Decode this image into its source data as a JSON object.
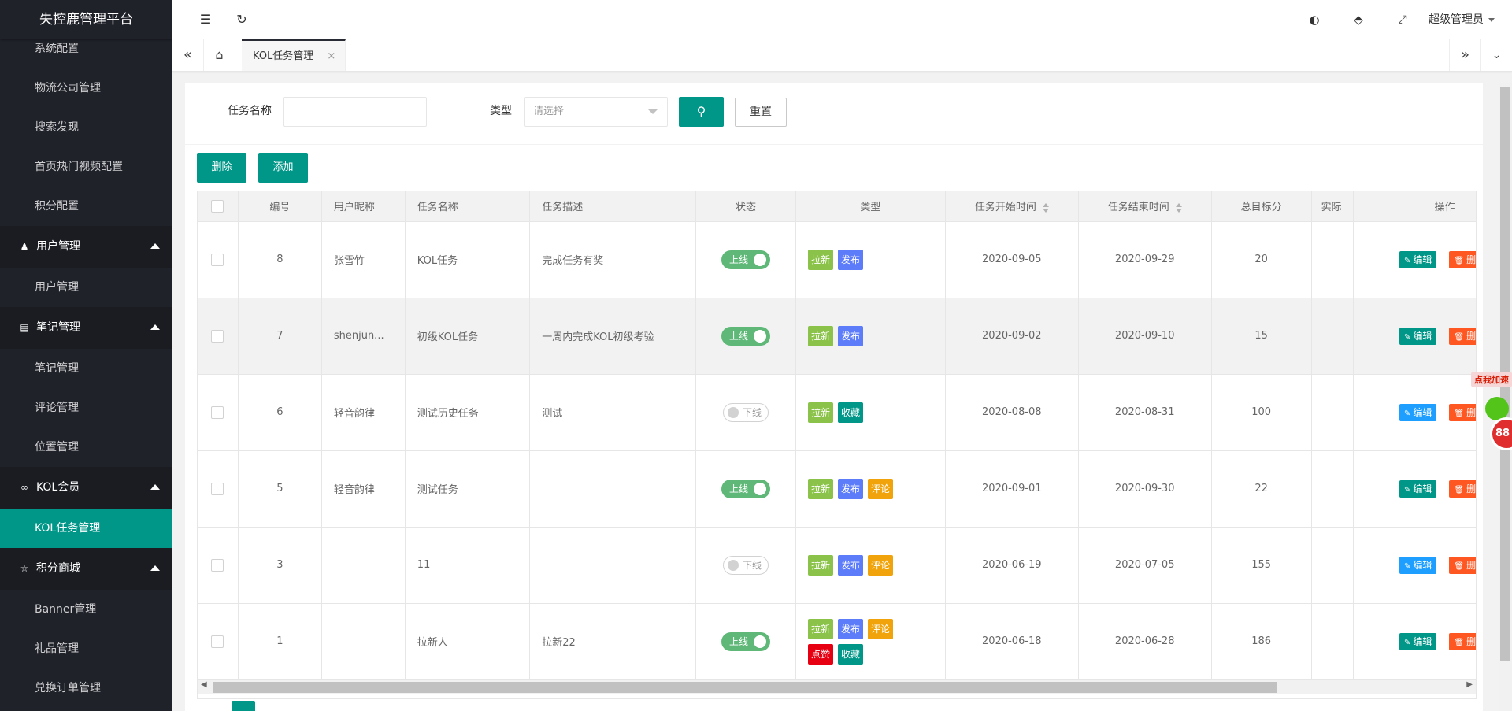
{
  "app": {
    "title": "失控鹿管理平台"
  },
  "sidebar": {
    "items": [
      {
        "label": "系统配置",
        "type": "item"
      },
      {
        "label": "物流公司管理",
        "type": "item"
      },
      {
        "label": "搜索发现",
        "type": "item"
      },
      {
        "label": "首页热门视频配置",
        "type": "item"
      },
      {
        "label": "积分配置",
        "type": "item"
      },
      {
        "label": "用户管理",
        "type": "group",
        "icon": "user-icon"
      },
      {
        "label": "用户管理",
        "type": "item"
      },
      {
        "label": "笔记管理",
        "type": "group",
        "icon": "book-icon"
      },
      {
        "label": "笔记管理",
        "type": "item"
      },
      {
        "label": "评论管理",
        "type": "item"
      },
      {
        "label": "位置管理",
        "type": "item"
      },
      {
        "label": "KOL会员",
        "type": "group",
        "icon": "link-icon"
      },
      {
        "label": "KOL任务管理",
        "type": "item",
        "active": true
      },
      {
        "label": "积分商城",
        "type": "group",
        "icon": "star-icon"
      },
      {
        "label": "Banner管理",
        "type": "item"
      },
      {
        "label": "礼品管理",
        "type": "item"
      },
      {
        "label": "兑换订单管理",
        "type": "item"
      }
    ]
  },
  "header": {
    "user": "超级管理员",
    "icons": [
      "menu-toggle-icon",
      "refresh-icon",
      "theme-icon",
      "tag-icon",
      "fullscreen-icon"
    ]
  },
  "tabs": [
    {
      "label": "KOL任务管理",
      "close": "×"
    }
  ],
  "filters": {
    "name_label": "任务名称",
    "name_value": "",
    "type_label": "类型",
    "type_placeholder": "请选择",
    "reset_label": "重置"
  },
  "toolbar": {
    "delete_label": "删除",
    "add_label": "添加"
  },
  "table": {
    "columns": [
      "编号",
      "用户昵称",
      "任务名称",
      "任务描述",
      "状态",
      "类型",
      "任务开始时间",
      "任务结束时间",
      "总目标分",
      "实际",
      "操作"
    ],
    "edit_label": "编辑",
    "delete_label": "删除",
    "rows": [
      {
        "id": "8",
        "user": "张雪竹",
        "name": "KOL任务",
        "desc": "完成任务有奖",
        "status": "上线",
        "on": true,
        "types": [
          "拉新",
          "发布"
        ],
        "start": "2020-09-05",
        "end": "2020-09-29",
        "target": "20",
        "actual": ""
      },
      {
        "id": "7",
        "user": "shenjun...",
        "name": "初级KOL任务",
        "desc": "一周内完成KOL初级考验",
        "status": "上线",
        "on": true,
        "types": [
          "拉新",
          "发布"
        ],
        "start": "2020-09-02",
        "end": "2020-09-10",
        "target": "15",
        "actual": ""
      },
      {
        "id": "6",
        "user": "轻音韵律",
        "name": "测试历史任务",
        "desc": "测试",
        "status": "下线",
        "on": false,
        "types": [
          "拉新",
          "收藏"
        ],
        "start": "2020-08-08",
        "end": "2020-08-31",
        "target": "100",
        "actual": ""
      },
      {
        "id": "5",
        "user": "轻音韵律",
        "name": "测试任务",
        "desc": "",
        "status": "上线",
        "on": true,
        "types": [
          "拉新",
          "发布",
          "评论"
        ],
        "start": "2020-09-01",
        "end": "2020-09-30",
        "target": "22",
        "actual": ""
      },
      {
        "id": "3",
        "user": "",
        "name": "11",
        "desc": "",
        "status": "下线",
        "on": false,
        "types": [
          "拉新",
          "发布",
          "评论"
        ],
        "start": "2020-06-19",
        "end": "2020-07-05",
        "target": "155",
        "actual": ""
      },
      {
        "id": "1",
        "user": "",
        "name": "拉新人",
        "desc": "拉新22",
        "status": "上线",
        "on": true,
        "types": [
          "拉新",
          "发布",
          "评论",
          "点赞",
          "收藏"
        ],
        "start": "2020-06-18",
        "end": "2020-06-28",
        "target": "186",
        "actual": ""
      }
    ]
  },
  "float_widget": {
    "ribbon": "点我加速",
    "badge": "88"
  },
  "colors": {
    "primary": "#009688",
    "sidebar_bg": "#20222a",
    "switch_on": "#5fb878",
    "tag_拉新": "#8bc34a",
    "tag_发布": "#5c7cfa",
    "tag_评论": "#f0a30a",
    "tag_收藏": "#009688",
    "tag_点赞": "#e60012",
    "edit_on": "#009688",
    "edit_off": "#1e9fff",
    "delete": "#ff5722"
  }
}
